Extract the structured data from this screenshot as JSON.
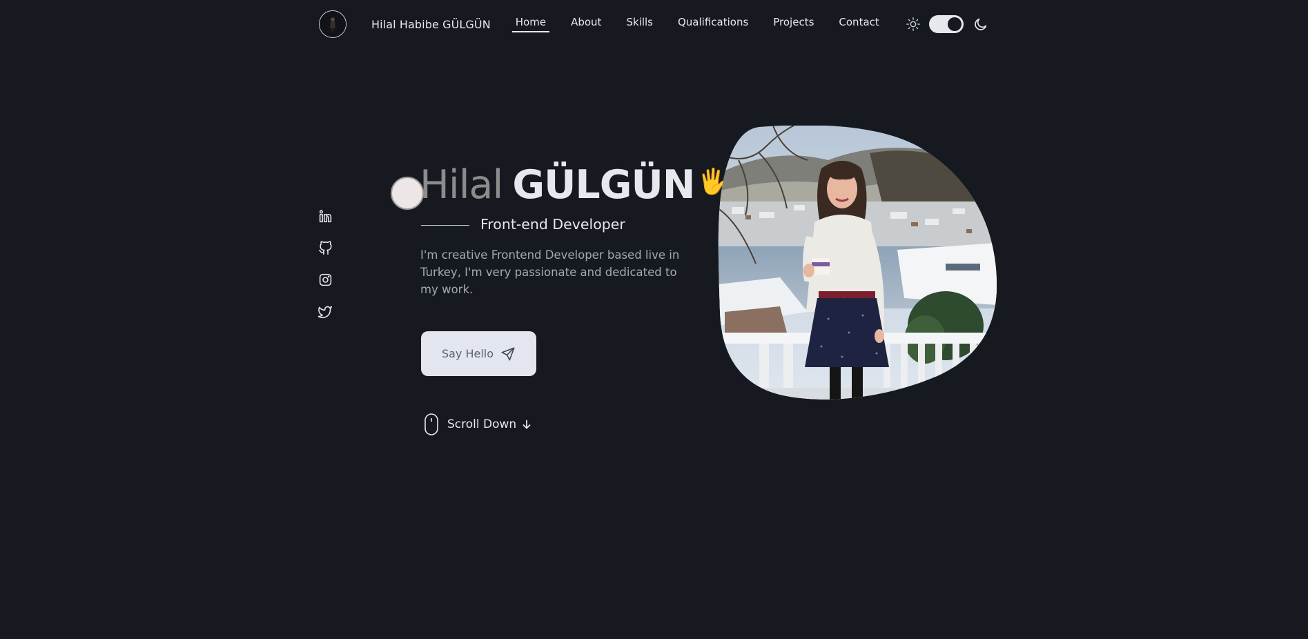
{
  "header": {
    "brand": "Hilal Habibe GÜLGÜN",
    "nav": [
      {
        "label": "Home",
        "active": true
      },
      {
        "label": "About",
        "active": false
      },
      {
        "label": "Skills",
        "active": false
      },
      {
        "label": "Qualifications",
        "active": false
      },
      {
        "label": "Projects",
        "active": false
      },
      {
        "label": "Contact",
        "active": false
      }
    ],
    "theme_toggle": {
      "mode": "dark"
    }
  },
  "socials": [
    "linkedin-icon",
    "github-icon",
    "instagram-icon",
    "twitter-icon"
  ],
  "hero": {
    "first_name": "Hilal",
    "last_name": "GÜLGÜN",
    "wave": "🖐",
    "subtitle": "Front-end Developer",
    "description": "I'm creative Frontend Developer based live in Turkey, I'm very passionate and dedicated to my work.",
    "cta_label": "Say Hello",
    "scroll_label": "Scroll Down"
  },
  "colors": {
    "background": "#161a20",
    "text": "#e6e8ee",
    "muted": "#a5a9b2",
    "button_bg": "#e3e6ee",
    "accent_wave": "#f5c542"
  }
}
